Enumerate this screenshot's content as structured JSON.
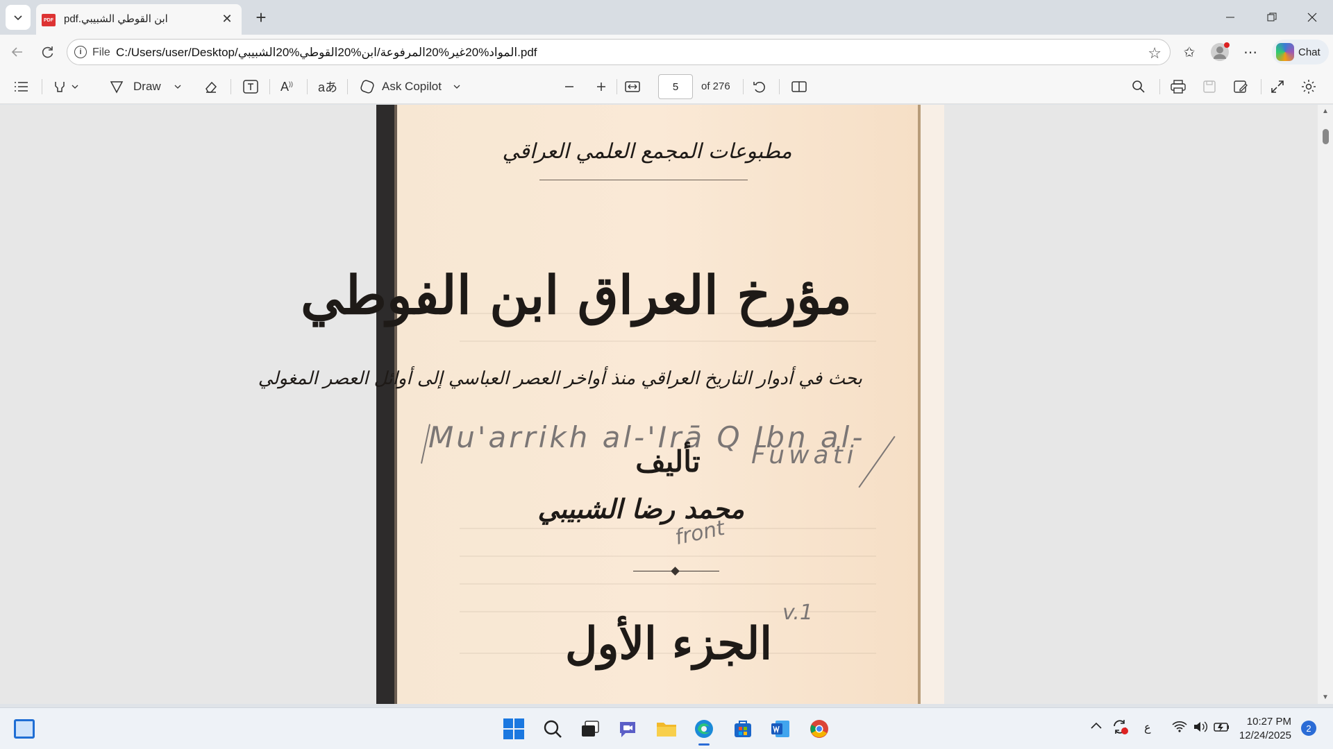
{
  "browser": {
    "tab": {
      "title": "ابن القوطي الشبيبي.pdf",
      "icon": "pdf-icon"
    },
    "address": {
      "file_label": "File",
      "url": "C:/Users/user/Desktop/المواد%20غير%20المرفوعة/ابن%20القوطي%20الشبيبي.pdf"
    },
    "chat_label": "Chat"
  },
  "pdf_toolbar": {
    "draw_label": "Draw",
    "ask_copilot_label": "Ask Copilot",
    "current_page": "5",
    "total_pages": "of 276"
  },
  "document": {
    "publisher": "مطبوعات المجمع العلمي العراقي",
    "title": "مؤرخ العراق ابن الفوطي",
    "subtitle": "بحث في أدوار التاريخ العراقي منذ أواخر العصر العباسي إلى أوائل العصر المغولي",
    "by_label": "تأليف",
    "author": "محمد رضا الشبيبي",
    "volume": "الجزء الأول",
    "handwritten": {
      "line1": "Mu'arrikh al-'Irā Q Ibn al-",
      "line2": "Fuwati",
      "note": "front",
      "volume_note": "v.1"
    }
  },
  "taskbar": {
    "clock_time": "10:27 PM",
    "clock_date": "12/24/2025",
    "notification_count": "2",
    "input_language": "ع"
  },
  "colors": {
    "accent": "#1b78e0",
    "paper": "#fae9d6",
    "spine": "#2d2b2b"
  }
}
